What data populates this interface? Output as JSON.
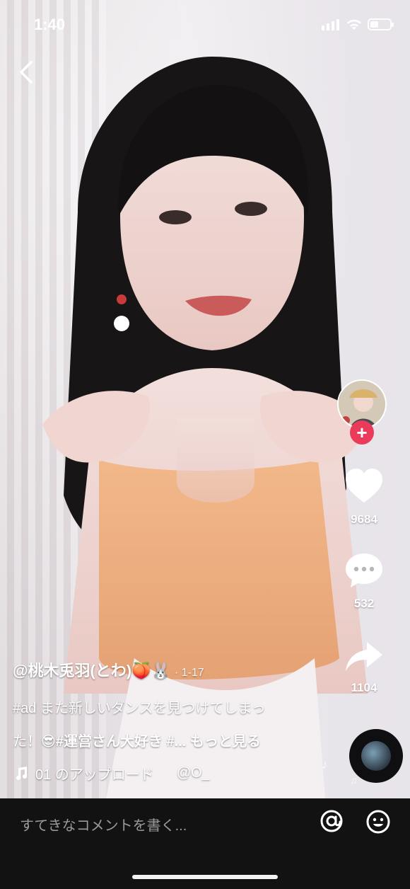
{
  "status": {
    "time": "1:40"
  },
  "rail": {
    "likes": "9684",
    "comments": "532",
    "shares": "1104"
  },
  "post": {
    "username": "@桃木兎羽(とわ)🍑🐰",
    "date": "· 1-17",
    "caption_line1": "#ad また新しいダンスを見つけてしまっ",
    "caption_line2_plain": "た！😎",
    "caption_hashtag": "#運営さん大好き #...",
    "more_label": "もっと見る",
    "music_title": "01 のアップロード",
    "music_by": "@O_"
  },
  "footer": {
    "comment_placeholder": "すてきなコメントを書く..."
  },
  "icons": {
    "back": "chevron-left-icon",
    "like": "heart-icon",
    "comment": "comment-icon",
    "share": "share-icon",
    "music": "music-note-icon",
    "mention": "at-icon",
    "emoji": "emoji-icon"
  },
  "colors": {
    "follow_plus": "#ea3b5a",
    "bottom_bar": "#121212"
  }
}
